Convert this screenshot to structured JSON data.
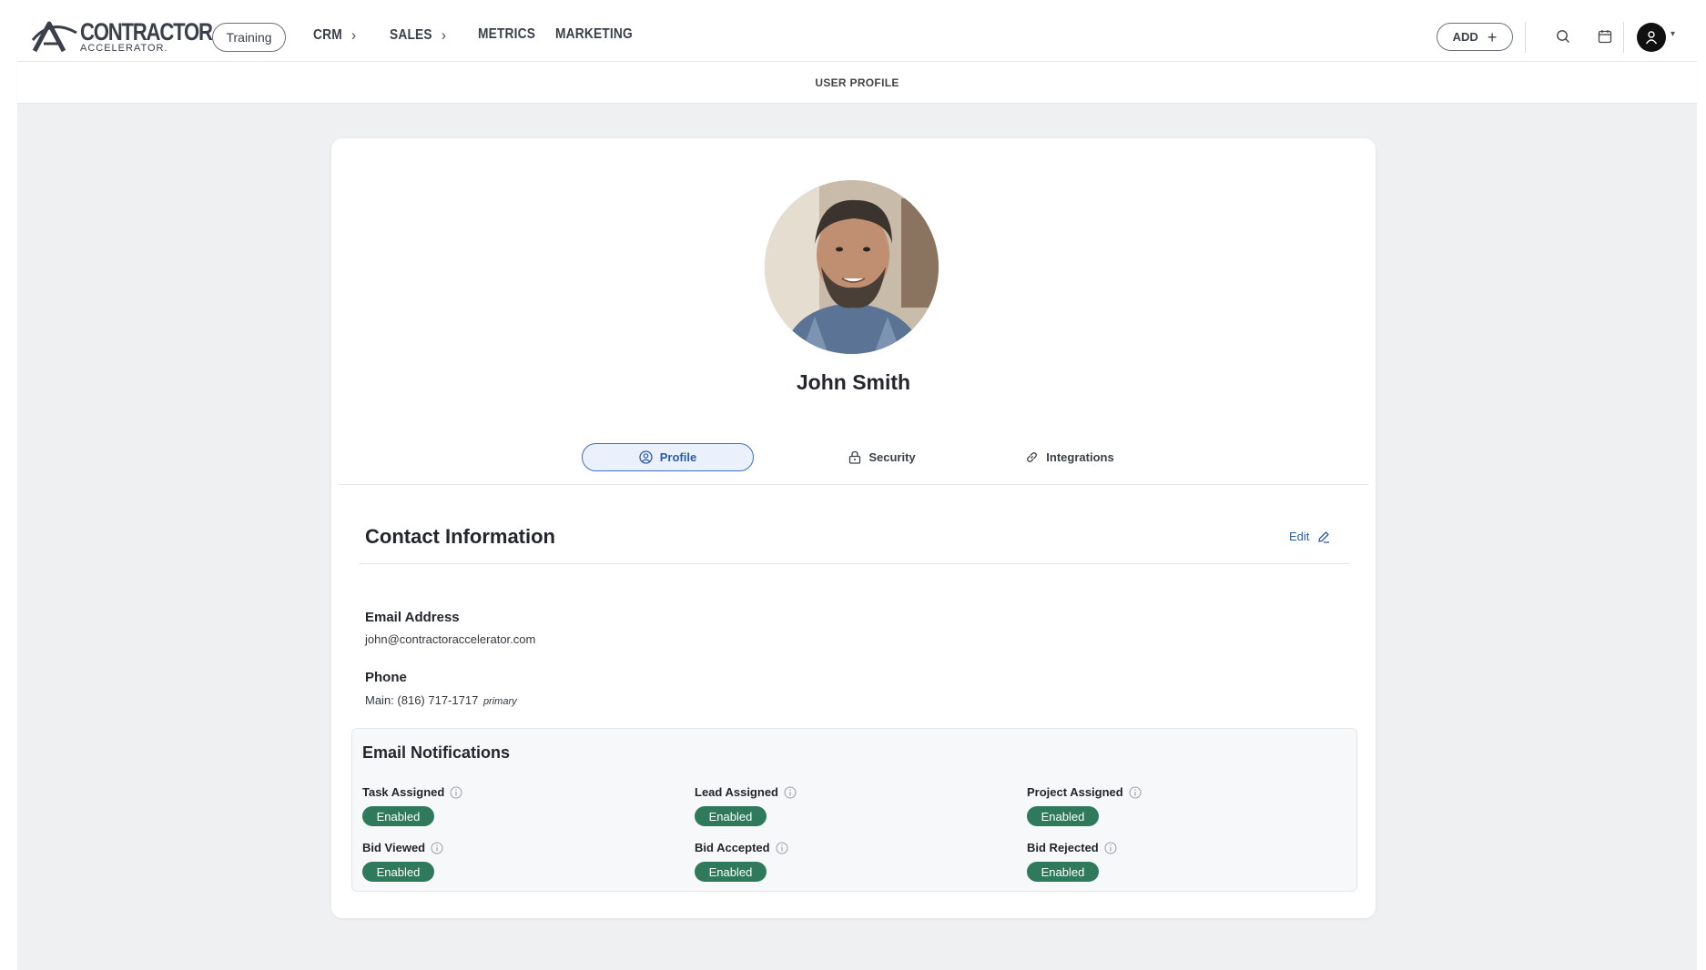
{
  "header": {
    "logo_main": "CONTRACTOR",
    "logo_sub": "ACCELERATOR.",
    "training_label": "Training",
    "nav": [
      {
        "label": "CRM",
        "has_submenu": true
      },
      {
        "label": "SALES",
        "has_submenu": true
      },
      {
        "label": "METRICS",
        "has_submenu": false
      },
      {
        "label": "MARKETING",
        "has_submenu": false
      }
    ],
    "add_label": "ADD",
    "icons": {
      "search": "search-icon",
      "calendar": "calendar-icon",
      "user": "user-avatar-icon"
    }
  },
  "subheader": {
    "title": "USER PROFILE"
  },
  "profile": {
    "name": "John Smith",
    "tabs": [
      {
        "label": "Profile",
        "icon": "user-circle-icon",
        "active": true
      },
      {
        "label": "Security",
        "icon": "lock-icon",
        "active": false
      },
      {
        "label": "Integrations",
        "icon": "link-icon",
        "active": false
      }
    ]
  },
  "contact": {
    "title": "Contact Information",
    "edit_label": "Edit",
    "email_label": "Email Address",
    "email_value": "john@contractoraccelerator.com",
    "phone_label": "Phone",
    "phone_value": "Main: (816) 717-1717",
    "phone_tag": "primary"
  },
  "notifications": {
    "title": "Email Notifications",
    "items": [
      {
        "label": "Task Assigned",
        "status": "Enabled"
      },
      {
        "label": "Lead Assigned",
        "status": "Enabled"
      },
      {
        "label": "Project Assigned",
        "status": "Enabled"
      },
      {
        "label": "Bid Viewed",
        "status": "Enabled"
      },
      {
        "label": "Bid Accepted",
        "status": "Enabled"
      },
      {
        "label": "Bid Rejected",
        "status": "Enabled"
      }
    ]
  },
  "colors": {
    "accent": "#2c5aa8",
    "badge": "#2f7a5c",
    "page_bg": "#eff0f2"
  }
}
